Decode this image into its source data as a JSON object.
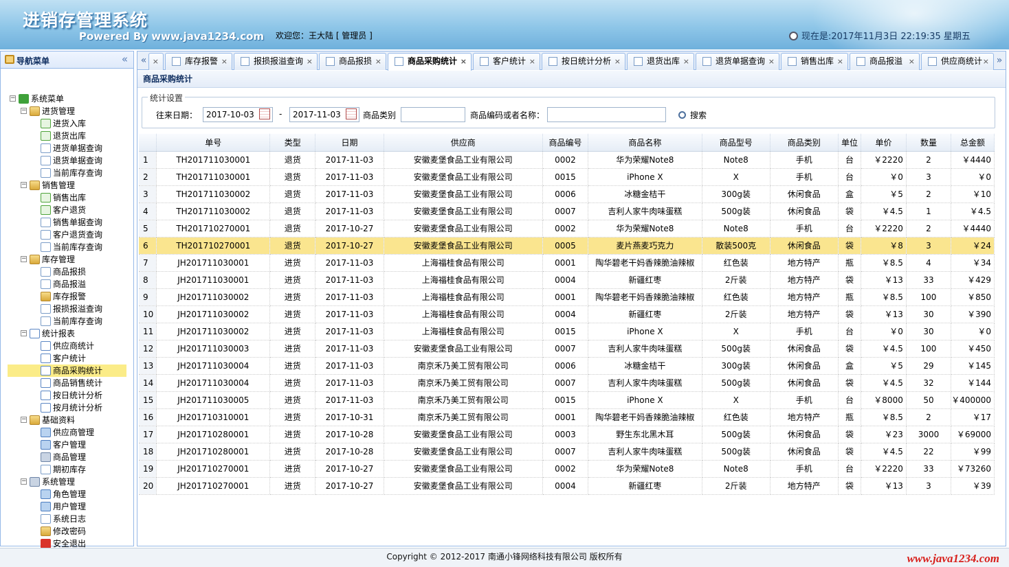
{
  "header": {
    "title": "进销存管理系统",
    "subtitle": "Powered By www.java1234.com",
    "welcome": "欢迎您：王大陆 [ 管理员 ]",
    "datetime": "现在是:2017年11月3日 22:19:35 星期五"
  },
  "sidebar": {
    "title": "导航菜单",
    "collapse_glyph": "«",
    "root": "系统菜单",
    "groups": [
      {
        "label": "进货管理",
        "items": [
          "进货入库",
          "退货出库",
          "进货单据查询",
          "退货单据查询",
          "当前库存查询"
        ]
      },
      {
        "label": "销售管理",
        "items": [
          "销售出库",
          "客户退货",
          "销售单据查询",
          "客户退货查询",
          "当前库存查询"
        ]
      },
      {
        "label": "库存管理",
        "items": [
          "商品报损",
          "商品报溢",
          "库存报警",
          "报损报溢查询",
          "当前库存查询"
        ]
      },
      {
        "label": "统计报表",
        "items": [
          "供应商统计",
          "客户统计",
          "商品采购统计",
          "商品销售统计",
          "按日统计分析",
          "按月统计分析"
        ]
      },
      {
        "label": "基础资料",
        "items": [
          "供应商管理",
          "客户管理",
          "商品管理",
          "期初库存"
        ]
      },
      {
        "label": "系统管理",
        "items": [
          "角色管理",
          "用户管理",
          "系统日志",
          "修改密码",
          "安全退出"
        ]
      }
    ]
  },
  "tabs": {
    "scroll_left": "«",
    "scroll_right": "»",
    "close_glyph": "×",
    "items": [
      {
        "label": ""
      },
      {
        "label": "库存报警"
      },
      {
        "label": "报损报溢查询"
      },
      {
        "label": "商品报损"
      },
      {
        "label": "商品采购统计"
      },
      {
        "label": "客户统计"
      },
      {
        "label": "按日统计分析"
      },
      {
        "label": "退货出库"
      },
      {
        "label": "退货单据查询"
      },
      {
        "label": "销售出库"
      },
      {
        "label": "商品报溢"
      },
      {
        "label": "供应商统计"
      }
    ]
  },
  "panel": {
    "title": "商品采购统计",
    "legend": "统计设置",
    "date_label": "往来日期：",
    "date_from": "2017-10-03",
    "date_sep": "-",
    "date_to": "2017-11-03",
    "type_label": "商品类别",
    "type_value": "",
    "code_label": "商品编码或者名称：",
    "code_value": "",
    "search_label": "搜索"
  },
  "table": {
    "columns": [
      "",
      "单号",
      "类型",
      "日期",
      "供应商",
      "商品编号",
      "商品名称",
      "商品型号",
      "商品类别",
      "单位",
      "单价",
      "数量",
      "总金额"
    ],
    "rows": [
      [
        "1",
        "TH201711030001",
        "退货",
        "2017-11-03",
        "安徽麦堡食品工业有限公司",
        "0002",
        "华为荣耀Note8",
        "Note8",
        "手机",
        "台",
        "￥2220",
        "2",
        "￥4440"
      ],
      [
        "2",
        "TH201711030001",
        "退货",
        "2017-11-03",
        "安徽麦堡食品工业有限公司",
        "0015",
        "iPhone X",
        "X",
        "手机",
        "台",
        "￥0",
        "3",
        "￥0"
      ],
      [
        "3",
        "TH201711030002",
        "退货",
        "2017-11-03",
        "安徽麦堡食品工业有限公司",
        "0006",
        "冰糖金桔干",
        "300g装",
        "休闲食品",
        "盒",
        "￥5",
        "2",
        "￥10"
      ],
      [
        "4",
        "TH201711030002",
        "退货",
        "2017-11-03",
        "安徽麦堡食品工业有限公司",
        "0007",
        "吉利人家牛肉味蛋糕",
        "500g装",
        "休闲食品",
        "袋",
        "￥4.5",
        "1",
        "￥4.5"
      ],
      [
        "5",
        "TH201710270001",
        "退货",
        "2017-10-27",
        "安徽麦堡食品工业有限公司",
        "0002",
        "华为荣耀Note8",
        "Note8",
        "手机",
        "台",
        "￥2220",
        "2",
        "￥4440"
      ],
      [
        "6",
        "TH201710270001",
        "退货",
        "2017-10-27",
        "安徽麦堡食品工业有限公司",
        "0005",
        "麦片燕麦巧克力",
        "散装500克",
        "休闲食品",
        "袋",
        "￥8",
        "3",
        "￥24"
      ],
      [
        "7",
        "JH201711030001",
        "进货",
        "2017-11-03",
        "上海福桂食品有限公司",
        "0001",
        "陶华碧老干妈香辣脆油辣椒",
        "红色装",
        "地方特产",
        "瓶",
        "￥8.5",
        "4",
        "￥34"
      ],
      [
        "8",
        "JH201711030001",
        "进货",
        "2017-11-03",
        "上海福桂食品有限公司",
        "0004",
        "新疆红枣",
        "2斤装",
        "地方特产",
        "袋",
        "￥13",
        "33",
        "￥429"
      ],
      [
        "9",
        "JH201711030002",
        "进货",
        "2017-11-03",
        "上海福桂食品有限公司",
        "0001",
        "陶华碧老干妈香辣脆油辣椒",
        "红色装",
        "地方特产",
        "瓶",
        "￥8.5",
        "100",
        "￥850"
      ],
      [
        "10",
        "JH201711030002",
        "进货",
        "2017-11-03",
        "上海福桂食品有限公司",
        "0004",
        "新疆红枣",
        "2斤装",
        "地方特产",
        "袋",
        "￥13",
        "30",
        "￥390"
      ],
      [
        "11",
        "JH201711030002",
        "进货",
        "2017-11-03",
        "上海福桂食品有限公司",
        "0015",
        "iPhone X",
        "X",
        "手机",
        "台",
        "￥0",
        "30",
        "￥0"
      ],
      [
        "12",
        "JH201711030003",
        "进货",
        "2017-11-03",
        "安徽麦堡食品工业有限公司",
        "0007",
        "吉利人家牛肉味蛋糕",
        "500g装",
        "休闲食品",
        "袋",
        "￥4.5",
        "100",
        "￥450"
      ],
      [
        "13",
        "JH201711030004",
        "进货",
        "2017-11-03",
        "南京禾乃美工贸有限公司",
        "0006",
        "冰糖金桔干",
        "300g装",
        "休闲食品",
        "盒",
        "￥5",
        "29",
        "￥145"
      ],
      [
        "14",
        "JH201711030004",
        "进货",
        "2017-11-03",
        "南京禾乃美工贸有限公司",
        "0007",
        "吉利人家牛肉味蛋糕",
        "500g装",
        "休闲食品",
        "袋",
        "￥4.5",
        "32",
        "￥144"
      ],
      [
        "15",
        "JH201711030005",
        "进货",
        "2017-11-03",
        "南京禾乃美工贸有限公司",
        "0015",
        "iPhone X",
        "X",
        "手机",
        "台",
        "￥8000",
        "50",
        "￥400000"
      ],
      [
        "16",
        "JH201710310001",
        "进货",
        "2017-10-31",
        "南京禾乃美工贸有限公司",
        "0001",
        "陶华碧老干妈香辣脆油辣椒",
        "红色装",
        "地方特产",
        "瓶",
        "￥8.5",
        "2",
        "￥17"
      ],
      [
        "17",
        "JH201710280001",
        "进货",
        "2017-10-28",
        "安徽麦堡食品工业有限公司",
        "0003",
        "野生东北黑木耳",
        "500g装",
        "休闲食品",
        "袋",
        "￥23",
        "3000",
        "￥69000"
      ],
      [
        "18",
        "JH201710280001",
        "进货",
        "2017-10-28",
        "安徽麦堡食品工业有限公司",
        "0007",
        "吉利人家牛肉味蛋糕",
        "500g装",
        "休闲食品",
        "袋",
        "￥4.5",
        "22",
        "￥99"
      ],
      [
        "19",
        "JH201710270001",
        "进货",
        "2017-10-27",
        "安徽麦堡食品工业有限公司",
        "0002",
        "华为荣耀Note8",
        "Note8",
        "手机",
        "台",
        "￥2220",
        "33",
        "￥73260"
      ],
      [
        "20",
        "JH201710270001",
        "进货",
        "2017-10-27",
        "安徽麦堡食品工业有限公司",
        "0004",
        "新疆红枣",
        "2斤装",
        "地方特产",
        "袋",
        "￥13",
        "3",
        "￥39"
      ]
    ]
  },
  "footer": {
    "copyright": "Copyright © 2012-2017 南通小锋网络科技有限公司 版权所有",
    "watermark": "www.java1234.com"
  },
  "colors": {
    "selected_row": "#fae58f",
    "selected_tree": "#fbec88",
    "border": "#95b8e7",
    "watermark": "#d8201c"
  }
}
